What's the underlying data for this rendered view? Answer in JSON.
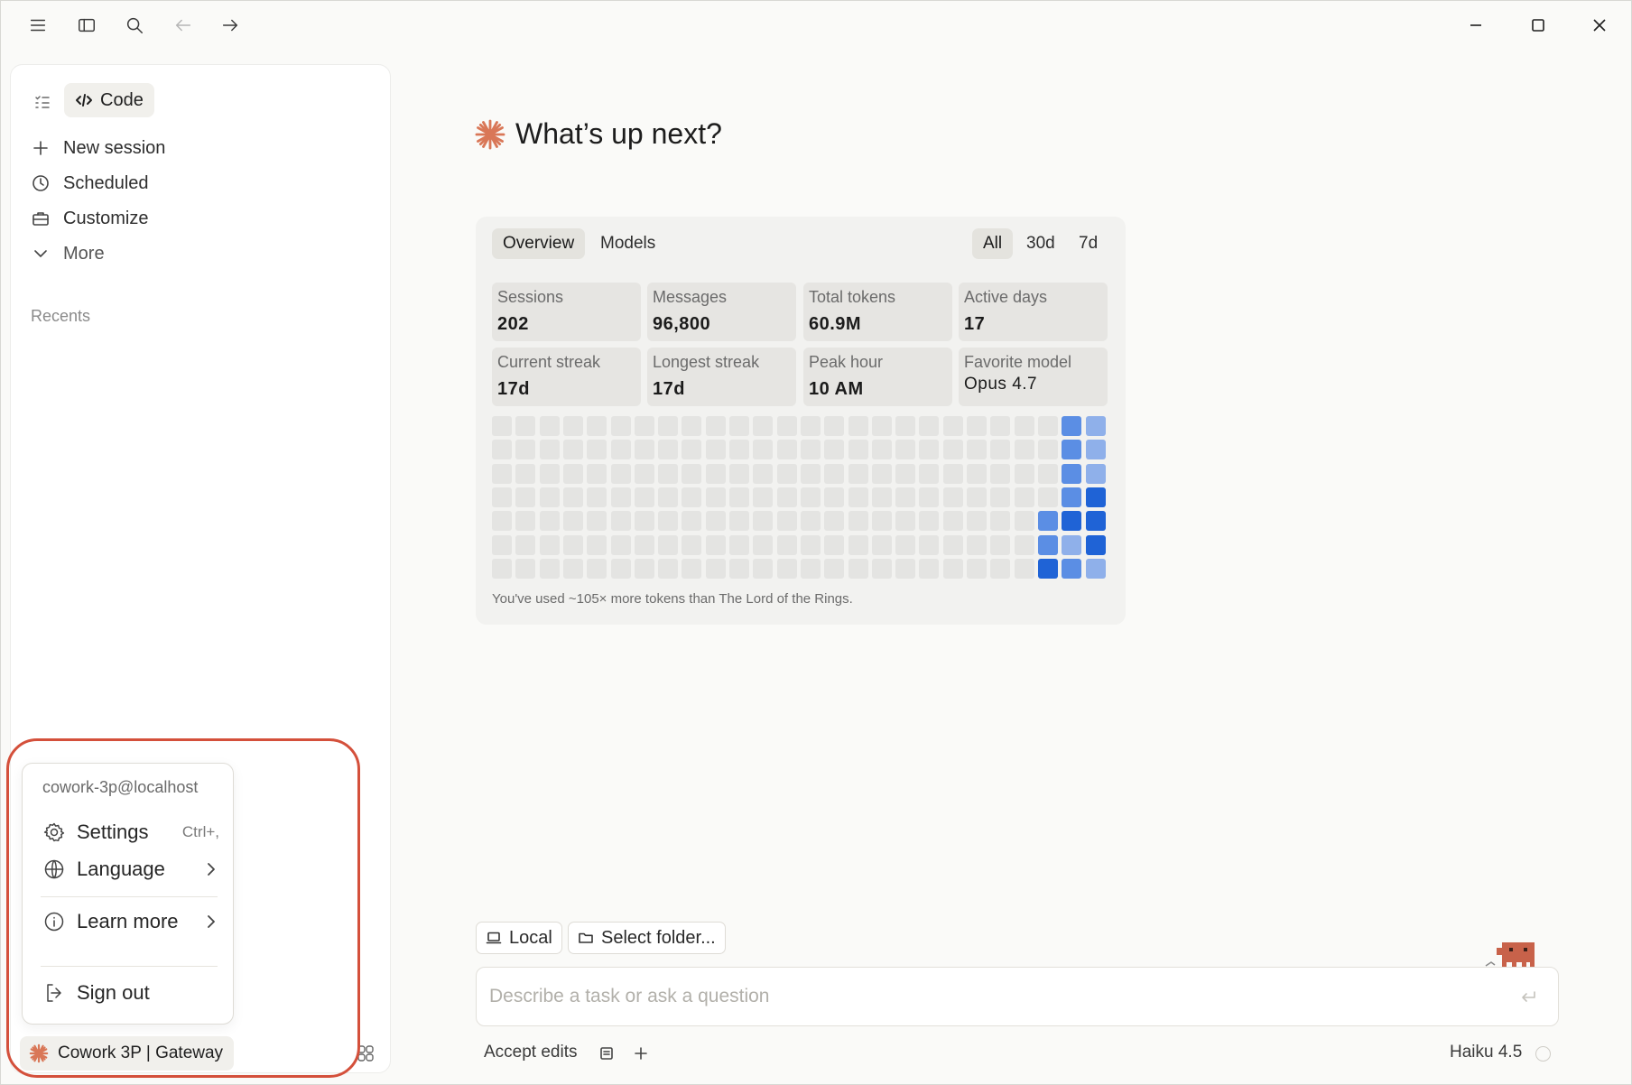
{
  "toolbar": {
    "icons": [
      "menu-icon",
      "sidebar-toggle-icon",
      "search-icon",
      "back-arrow-icon",
      "forward-arrow-icon"
    ],
    "window_controls": [
      "minimize-icon",
      "maximize-icon",
      "close-icon"
    ]
  },
  "sidebar": {
    "mode_label": "Code",
    "nav": [
      {
        "label": "New session",
        "icon": "plus-icon"
      },
      {
        "label": "Scheduled",
        "icon": "clock-icon"
      },
      {
        "label": "Customize",
        "icon": "briefcase-icon"
      },
      {
        "label": "More",
        "icon": "chevron-down-icon"
      }
    ],
    "recents_label": "Recents"
  },
  "account_menu": {
    "email": "cowork-3p@localhost",
    "settings_label": "Settings",
    "settings_shortcut": "Ctrl+,",
    "language_label": "Language",
    "learn_more_label": "Learn more",
    "sign_out_label": "Sign out"
  },
  "org": {
    "label": "Cowork 3P | Gateway"
  },
  "main": {
    "heading": "What’s up next?",
    "accent_color": "#d97757"
  },
  "stats": {
    "tabs": [
      "Overview",
      "Models"
    ],
    "active_tab": "Overview",
    "ranges": [
      "All",
      "30d",
      "7d"
    ],
    "active_range": "All",
    "cards": [
      {
        "label": "Sessions",
        "value": "202"
      },
      {
        "label": "Messages",
        "value": "96,800"
      },
      {
        "label": "Total tokens",
        "value": "60.9M"
      },
      {
        "label": "Active days",
        "value": "17"
      },
      {
        "label": "Current streak",
        "value": "17d"
      },
      {
        "label": "Longest streak",
        "value": "17d"
      },
      {
        "label": "Peak hour",
        "value": "10 AM"
      },
      {
        "label": "Favorite model",
        "value": "Opus 4.7"
      }
    ],
    "heatmap_colors": {
      "0": "#e4e4e2",
      "1": "#8fb0ea",
      "2": "#5b8ee4",
      "3": "#1f63d6"
    },
    "heatmap_columns_levels": [
      [
        0,
        0,
        0,
        0,
        0,
        0,
        0
      ],
      [
        0,
        0,
        0,
        0,
        0,
        0,
        0
      ],
      [
        0,
        0,
        0,
        0,
        0,
        0,
        0
      ],
      [
        0,
        0,
        0,
        0,
        0,
        0,
        0
      ],
      [
        0,
        0,
        0,
        0,
        0,
        0,
        0
      ],
      [
        0,
        0,
        0,
        0,
        0,
        0,
        0
      ],
      [
        0,
        0,
        0,
        0,
        0,
        0,
        0
      ],
      [
        0,
        0,
        0,
        0,
        0,
        0,
        0
      ],
      [
        0,
        0,
        0,
        0,
        0,
        0,
        0
      ],
      [
        0,
        0,
        0,
        0,
        0,
        0,
        0
      ],
      [
        0,
        0,
        0,
        0,
        0,
        0,
        0
      ],
      [
        0,
        0,
        0,
        0,
        0,
        0,
        0
      ],
      [
        0,
        0,
        0,
        0,
        0,
        0,
        0
      ],
      [
        0,
        0,
        0,
        0,
        0,
        0,
        0
      ],
      [
        0,
        0,
        0,
        0,
        0,
        0,
        0
      ],
      [
        0,
        0,
        0,
        0,
        0,
        0,
        0
      ],
      [
        0,
        0,
        0,
        0,
        0,
        0,
        0
      ],
      [
        0,
        0,
        0,
        0,
        0,
        0,
        0
      ],
      [
        0,
        0,
        0,
        0,
        0,
        0,
        0
      ],
      [
        0,
        0,
        0,
        0,
        0,
        0,
        0
      ],
      [
        0,
        0,
        0,
        0,
        0,
        0,
        0
      ],
      [
        0,
        0,
        0,
        0,
        0,
        0,
        0
      ],
      [
        0,
        0,
        0,
        0,
        0,
        0,
        0
      ],
      [
        0,
        0,
        0,
        0,
        2,
        2,
        3
      ],
      [
        2,
        2,
        2,
        2,
        3,
        1,
        2
      ],
      [
        1,
        1,
        1,
        3,
        3,
        3,
        1
      ]
    ],
    "footnote": "You've used ~105× more tokens than The Lord of the Rings."
  },
  "composer": {
    "env_label": "Local",
    "folder_label": "Select folder...",
    "placeholder": "Describe a task or ask a question",
    "mode_label": "Accept edits",
    "model_label": "Haiku 4.5"
  }
}
